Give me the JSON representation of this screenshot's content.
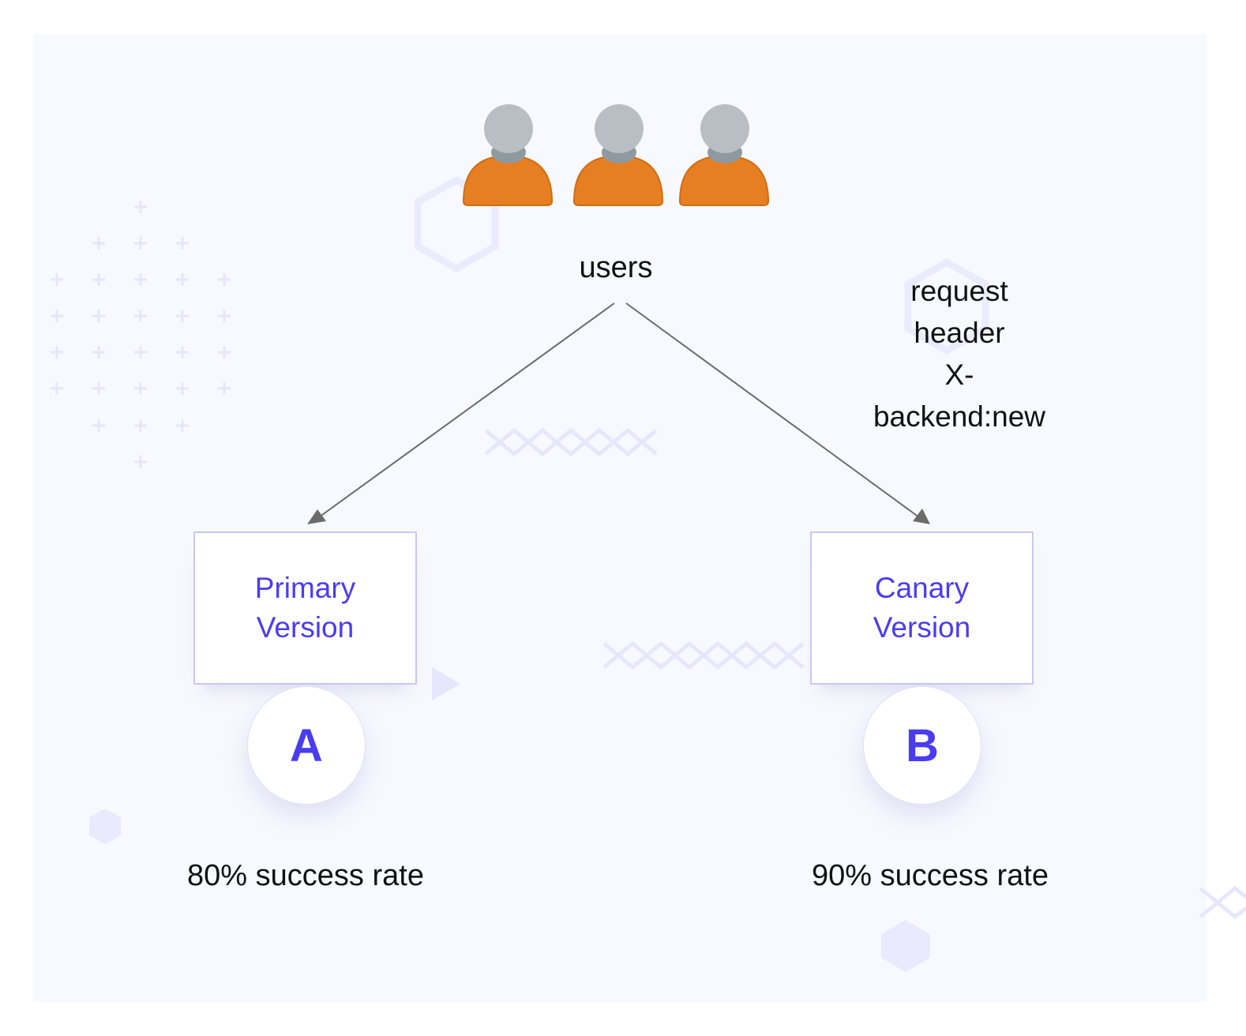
{
  "users": {
    "label": "users",
    "icons": [
      "user-icon",
      "user-icon",
      "user-icon"
    ],
    "colors": {
      "body": "#e67e22",
      "head": "#b9bec4",
      "neck": "#8e9aa0"
    }
  },
  "routing_rule": {
    "lines": [
      "request",
      "header",
      "X-",
      "backend:new"
    ]
  },
  "versions": [
    {
      "title_line1": "Primary",
      "title_line2": "Version",
      "badge": "A",
      "success_rate": "80% success rate"
    },
    {
      "title_line1": "Canary",
      "title_line2": "Version",
      "badge": "B",
      "success_rate": "90% success rate"
    }
  ],
  "colors": {
    "accent": "#4a3cf0",
    "box_border": "#c9c6f8",
    "arrow": "#6b6b6b",
    "panel_bg": "#f8f9fe",
    "decoration": "#e8e6fc"
  }
}
